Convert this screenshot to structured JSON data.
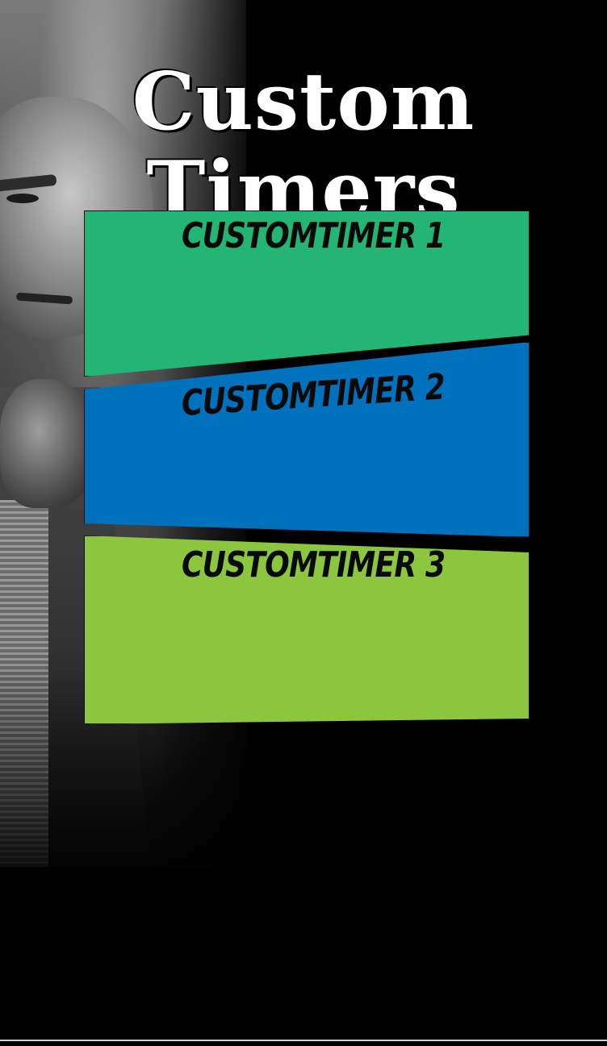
{
  "app": {
    "title": "Custom Timers"
  },
  "timers": [
    {
      "label": "Customtimer 1",
      "color": "#22b573"
    },
    {
      "label": "Customtimer 2",
      "color": "#0071bc"
    },
    {
      "label": "Customtimer 3",
      "color": "#8cc63f"
    }
  ],
  "colors": {
    "background": "#000000",
    "title_text": "#ffffff",
    "label_text": "#0a0a0a"
  },
  "icons": {
    "background_art": "character-portrait-illustration"
  }
}
